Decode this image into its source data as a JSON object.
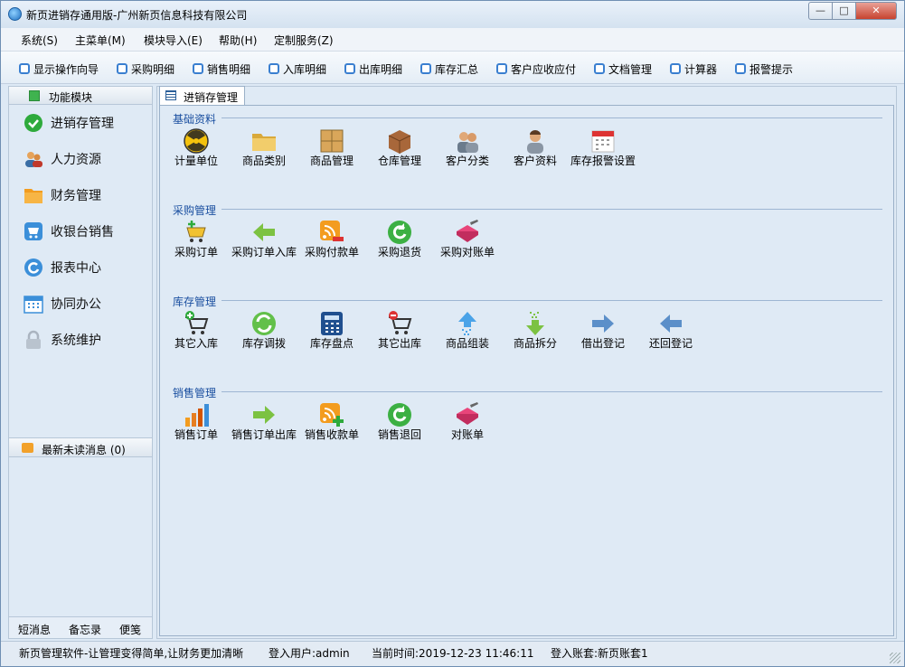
{
  "window": {
    "title": "新页进销存通用版-广州新页信息科技有限公司"
  },
  "menu": [
    "系统(S)",
    "主菜单(M)",
    "模块导入(E)",
    "帮助(H)",
    "定制服务(Z)"
  ],
  "toolbar": [
    "显示操作向导",
    "采购明细",
    "销售明细",
    "入库明细",
    "出库明细",
    "库存汇总",
    "客户应收应付",
    "文档管理",
    "计算器",
    "报警提示"
  ],
  "sidebar": {
    "header": "功能模块",
    "items": [
      "进销存管理",
      "人力资源",
      "财务管理",
      "收银台销售",
      "报表中心",
      "协同办公",
      "系统维护"
    ],
    "messages": "最新未读消息 (0)",
    "footer": [
      "短消息",
      "备忘录",
      "便笺"
    ]
  },
  "tab": "进销存管理",
  "sections": [
    {
      "title": "基础资料",
      "items": [
        "计量单位",
        "商品类别",
        "商品管理",
        "仓库管理",
        "客户分类",
        "客户资料",
        "库存报警设置"
      ]
    },
    {
      "title": "采购管理",
      "items": [
        "采购订单",
        "采购订单入库",
        "采购付款单",
        "采购退货",
        "采购对账单"
      ]
    },
    {
      "title": "库存管理",
      "items": [
        "其它入库",
        "库存调拨",
        "库存盘点",
        "其它出库",
        "商品组装",
        "商品拆分",
        "借出登记",
        "还回登记"
      ]
    },
    {
      "title": "销售管理",
      "items": [
        "销售订单",
        "销售订单出库",
        "销售收款单",
        "销售退回",
        "对账单"
      ]
    }
  ],
  "status": {
    "slogan": "新页管理软件-让管理变得简单,让财务更加清晰",
    "user": "登入用户:admin",
    "time": "当前时间:2019-12-23 11:46:11",
    "account": "登入账套:新页账套1"
  },
  "colors": {
    "accent": "#1a4fa0",
    "background": "#dfeaf5"
  }
}
